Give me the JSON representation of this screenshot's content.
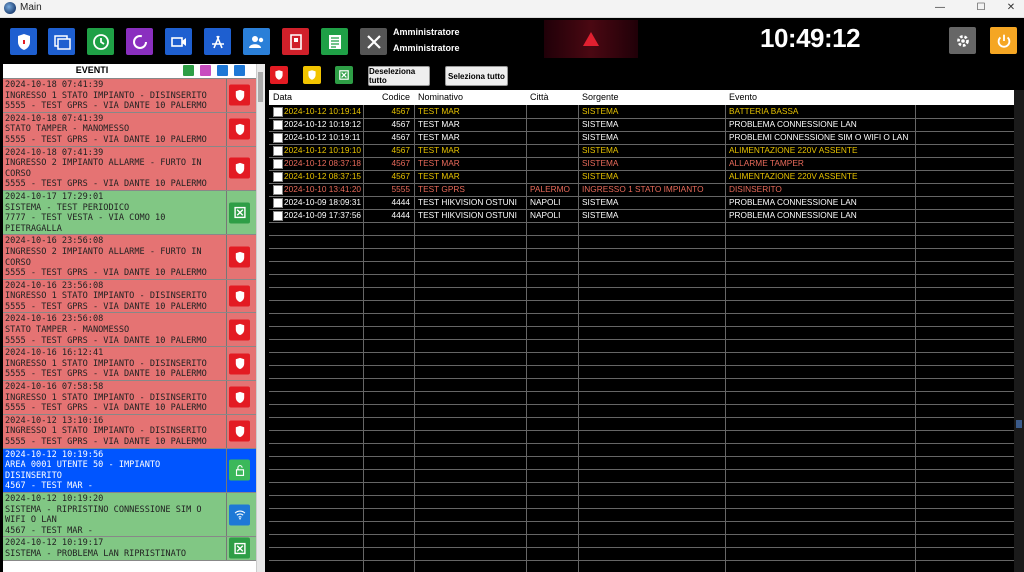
{
  "window": {
    "title": "Main",
    "minimize": "—",
    "maximize": "☐",
    "close": "✕"
  },
  "header": {
    "user_line1": "Amministratore",
    "user_line2": "Amministratore",
    "clock": "10:49:12"
  },
  "colors": {
    "red_event": "#e57373",
    "green_event": "#81c784",
    "blue_event": "#0055ff",
    "yellow_text": "#e6c200",
    "salmon_text": "#e86a5a"
  },
  "events_panel": {
    "title": "EVENTI",
    "items": [
      {
        "lines": [
          "2024-10-18 07:41:39",
          "INGRESSO 1 STATO IMPIANTO - DISINSERITO",
          "5555 - TEST GPRS - VIA DANTE 10 PALERMO"
        ],
        "color": "red",
        "icon": "shield-icon"
      },
      {
        "lines": [
          "2024-10-18 07:41:39",
          "STATO TAMPER - MANOMESSO",
          "5555 - TEST GPRS - VIA DANTE 10 PALERMO"
        ],
        "color": "red",
        "icon": "shield-icon"
      },
      {
        "lines": [
          "2024-10-18 07:41:39",
          "INGRESSO 2 IMPIANTO ALLARME - FURTO IN",
          "CORSO",
          "5555 - TEST GPRS - VIA DANTE 10 PALERMO"
        ],
        "color": "red",
        "icon": "shield-icon"
      },
      {
        "lines": [
          "2024-10-17 17:29:01",
          "SISTEMA - TEST PERIODICO",
          "7777 - TEST VESTA - VIA COMO 10",
          "PIETRAGALLA"
        ],
        "color": "green",
        "icon": "x-box-icon"
      },
      {
        "lines": [
          "2024-10-16 23:56:08",
          "INGRESSO 2 IMPIANTO ALLARME - FURTO IN",
          "CORSO",
          "5555 - TEST GPRS - VIA DANTE 10 PALERMO"
        ],
        "color": "red",
        "icon": "shield-icon"
      },
      {
        "lines": [
          "2024-10-16 23:56:08",
          "INGRESSO 1 STATO IMPIANTO - DISINSERITO",
          "5555 - TEST GPRS - VIA DANTE 10 PALERMO"
        ],
        "color": "red",
        "icon": "shield-icon"
      },
      {
        "lines": [
          "2024-10-16 23:56:08",
          "STATO TAMPER - MANOMESSO",
          "5555 - TEST GPRS - VIA DANTE 10 PALERMO"
        ],
        "color": "red",
        "icon": "shield-icon"
      },
      {
        "lines": [
          "2024-10-16 16:12:41",
          "INGRESSO 1 STATO IMPIANTO - DISINSERITO",
          "5555 - TEST GPRS - VIA DANTE 10 PALERMO"
        ],
        "color": "red",
        "icon": "shield-icon"
      },
      {
        "lines": [
          "2024-10-16 07:58:58",
          "INGRESSO 1 STATO IMPIANTO - DISINSERITO",
          "5555 - TEST GPRS - VIA DANTE 10 PALERMO"
        ],
        "color": "red",
        "icon": "shield-icon"
      },
      {
        "lines": [
          "2024-10-12 13:10:16",
          "INGRESSO 1 STATO IMPIANTO - DISINSERITO",
          "5555 - TEST GPRS - VIA DANTE 10 PALERMO"
        ],
        "color": "red",
        "icon": "shield-icon"
      },
      {
        "lines": [
          "2024-10-12 10:19:56",
          "AREA 0001 UTENTE 50 - IMPIANTO",
          "DISINSERITO",
          "4567 - TEST MAR -"
        ],
        "color": "blue",
        "icon": "unlock-icon"
      },
      {
        "lines": [
          "2024-10-12 10:19:20",
          "SISTEMA - RIPRISTINO CONNESSIONE SIM O",
          "WIFI O LAN",
          "4567 - TEST MAR -"
        ],
        "color": "green",
        "icon": "wifi-icon"
      },
      {
        "lines": [
          "2024-10-12 10:19:17",
          "SISTEMA - PROBLEMA LAN RIPRISTINATO"
        ],
        "color": "green",
        "icon": "x-box-icon"
      }
    ]
  },
  "actions": {
    "deselect_all": "Deseleziona tutto",
    "select_all": "Seleziona tutto"
  },
  "table": {
    "columns": [
      "Data",
      "Codice",
      "Nominativo",
      "Città",
      "Sorgente",
      "Evento"
    ],
    "rows": [
      {
        "data": "2024-10-12 10:19:14",
        "codice": "4567",
        "nominativo": "TEST MAR",
        "citta": "",
        "sorgente": "SISTEMA",
        "evento": "BATTERIA BASSA",
        "style": "yellow"
      },
      {
        "data": "2024-10-12 10:19:12",
        "codice": "4567",
        "nominativo": "TEST MAR",
        "citta": "",
        "sorgente": "SISTEMA",
        "evento": "PROBLEMA CONNESSIONE LAN",
        "style": "white"
      },
      {
        "data": "2024-10-12 10:19:11",
        "codice": "4567",
        "nominativo": "TEST MAR",
        "citta": "",
        "sorgente": "SISTEMA",
        "evento": "PROBLEMI CONNESSIONE SIM O WIFI O LAN",
        "style": "white"
      },
      {
        "data": "2024-10-12 10:19:10",
        "codice": "4567",
        "nominativo": "TEST MAR",
        "citta": "",
        "sorgente": "SISTEMA",
        "evento": "ALIMENTAZIONE 220V ASSENTE",
        "style": "yellow"
      },
      {
        "data": "2024-10-12 08:37:18",
        "codice": "4567",
        "nominativo": "TEST MAR",
        "citta": "",
        "sorgente": "SISTEMA",
        "evento": "ALLARME TAMPER",
        "style": "salmon"
      },
      {
        "data": "2024-10-12 08:37:15",
        "codice": "4567",
        "nominativo": "TEST MAR",
        "citta": "",
        "sorgente": "SISTEMA",
        "evento": "ALIMENTAZIONE 220V ASSENTE",
        "style": "yellow"
      },
      {
        "data": "2024-10-10 13:41:20",
        "codice": "5555",
        "nominativo": "TEST GPRS",
        "citta": "PALERMO",
        "sorgente": "INGRESSO 1 STATO IMPIANTO",
        "evento": "DISINSERITO",
        "style": "salmon"
      },
      {
        "data": "2024-10-09 18:09:31",
        "codice": "4444",
        "nominativo": "TEST HIKVISION OSTUNI",
        "citta": "NAPOLI",
        "sorgente": "SISTEMA",
        "evento": "PROBLEMA CONNESSIONE LAN",
        "style": "white"
      },
      {
        "data": "2024-10-09 17:37:56",
        "codice": "4444",
        "nominativo": "TEST HIKVISION OSTUNI",
        "citta": "NAPOLI",
        "sorgente": "SISTEMA",
        "evento": "PROBLEMA CONNESSIONE LAN",
        "style": "white"
      }
    ]
  }
}
